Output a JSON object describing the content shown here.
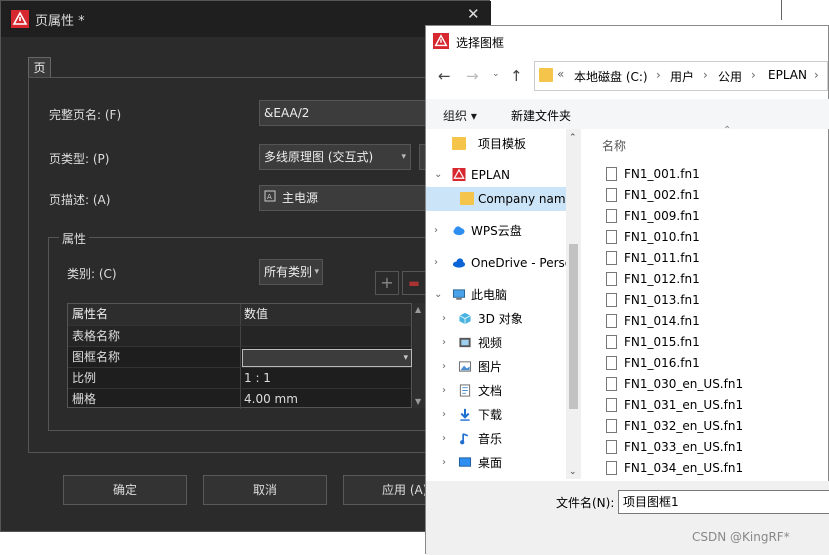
{
  "dark_dialog": {
    "title": "页属性 *",
    "tab": "页",
    "full_page_name_label": "完整页名: (F)",
    "full_page_name_value": "&EAA/2",
    "page_type_label": "页类型: (P)",
    "page_type_value": "多线原理图 (交互式)",
    "page_desc_label": "页描述: (A)",
    "page_desc_value": "主电源",
    "props_group": "属性",
    "category_label": "类别: (C)",
    "category_value": "所有类别",
    "grid_headers": [
      "属性名",
      "数值"
    ],
    "grid_rows": [
      {
        "name": "表格名称",
        "value": ""
      },
      {
        "name": "图框名称",
        "value": ""
      },
      {
        "name": "比例",
        "value": "1 : 1"
      },
      {
        "name": "栅格",
        "value": "4.00 mm"
      }
    ],
    "ok": "确定",
    "cancel": "取消",
    "apply": "应用 (A)"
  },
  "file_dialog": {
    "title": "选择图框",
    "breadcrumb": [
      "本地磁盘 (C:)",
      "用户",
      "公用",
      "EPLAN"
    ],
    "organize": "组织",
    "new_folder": "新建文件夹",
    "column_name": "名称",
    "tree": [
      {
        "label": "项目模板",
        "kind": "folder"
      },
      {
        "label": "EPLAN",
        "kind": "eplan"
      },
      {
        "label": "Company name",
        "kind": "folder"
      },
      {
        "label": "WPS云盘",
        "kind": "cloud"
      },
      {
        "label": "OneDrive - Personal",
        "kind": "onedrive"
      },
      {
        "label": "此电脑",
        "kind": "pc"
      },
      {
        "label": "3D 对象",
        "kind": "3d"
      },
      {
        "label": "视频",
        "kind": "video"
      },
      {
        "label": "图片",
        "kind": "picture"
      },
      {
        "label": "文档",
        "kind": "doc"
      },
      {
        "label": "下载",
        "kind": "download"
      },
      {
        "label": "音乐",
        "kind": "music"
      },
      {
        "label": "桌面",
        "kind": "desktop"
      }
    ],
    "files": [
      "FN1_001.fn1",
      "FN1_002.fn1",
      "FN1_009.fn1",
      "FN1_010.fn1",
      "FN1_011.fn1",
      "FN1_012.fn1",
      "FN1_013.fn1",
      "FN1_014.fn1",
      "FN1_015.fn1",
      "FN1_016.fn1",
      "FN1_030_en_US.fn1",
      "FN1_031_en_US.fn1",
      "FN1_032_en_US.fn1",
      "FN1_033_en_US.fn1",
      "FN1_034_en_US.fn1"
    ],
    "filename_label": "文件名(N):",
    "filename_value": "项目图框1"
  },
  "watermark": "CSDN @KingRF*"
}
